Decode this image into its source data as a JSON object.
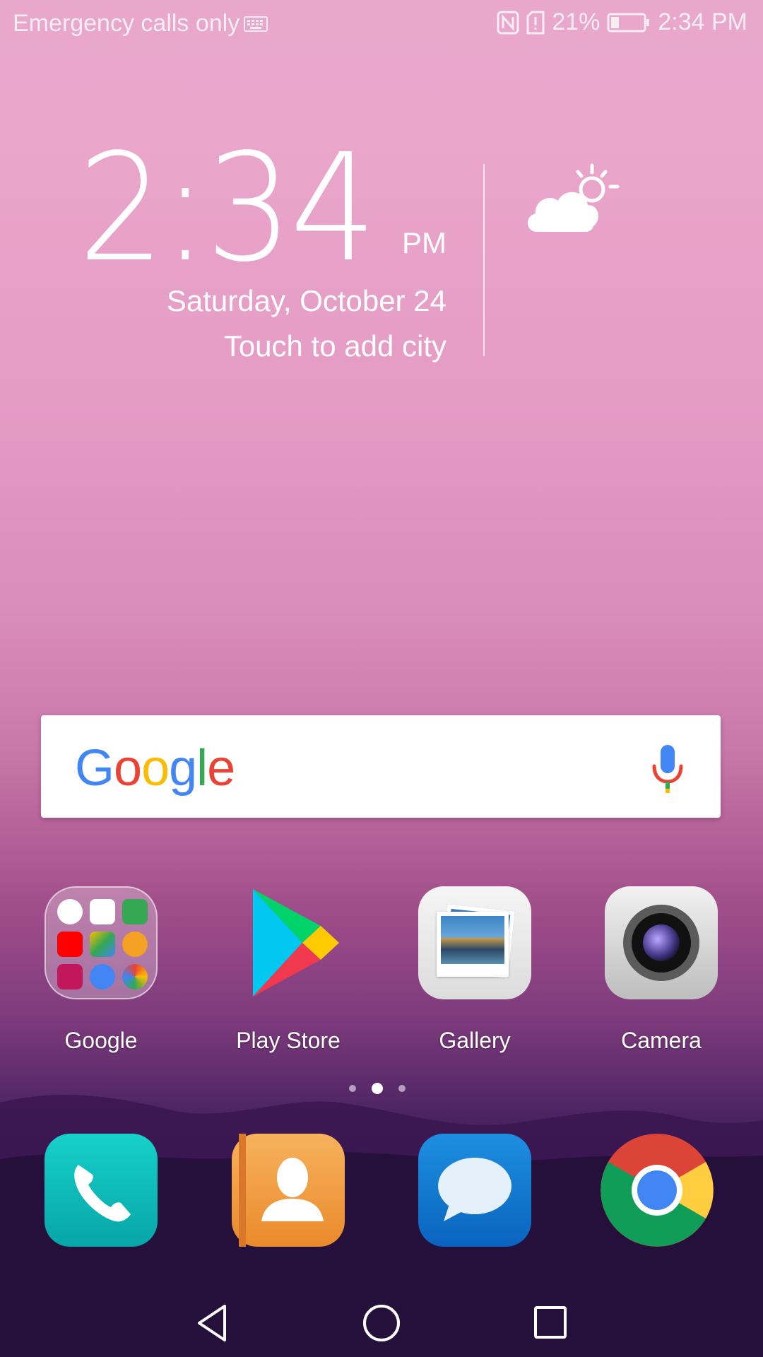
{
  "status_bar": {
    "carrier_text": "Emergency calls only",
    "battery_percent": "21%",
    "time": "2:34 PM",
    "icons": [
      "keyboard-icon",
      "nfc-icon",
      "sim-alert-icon",
      "battery-icon"
    ]
  },
  "clock_widget": {
    "time": "2:34",
    "ampm": "PM",
    "date": "Saturday, October 24",
    "city_prompt": "Touch to add city",
    "weather_icon": "partly-cloudy-icon"
  },
  "search_bar": {
    "logo": "Google",
    "mic_icon": "mic-icon"
  },
  "apps": [
    {
      "label": "Google",
      "icon": "google-folder-icon"
    },
    {
      "label": "Play Store",
      "icon": "play-store-icon"
    },
    {
      "label": "Gallery",
      "icon": "gallery-icon"
    },
    {
      "label": "Camera",
      "icon": "camera-icon"
    }
  ],
  "page_indicator": {
    "count": 3,
    "active_index": 1
  },
  "dock": [
    {
      "name": "Phone",
      "icon": "phone-icon"
    },
    {
      "name": "Contacts",
      "icon": "contacts-icon"
    },
    {
      "name": "Messages",
      "icon": "messages-icon"
    },
    {
      "name": "Chrome",
      "icon": "chrome-icon"
    }
  ],
  "nav_bar": {
    "icons": [
      "back-icon",
      "home-icon",
      "recents-icon"
    ]
  },
  "colors": {
    "google_blue": "#4285F4",
    "google_red": "#EA4335",
    "google_yellow": "#FBBC05",
    "google_green": "#34A853"
  }
}
